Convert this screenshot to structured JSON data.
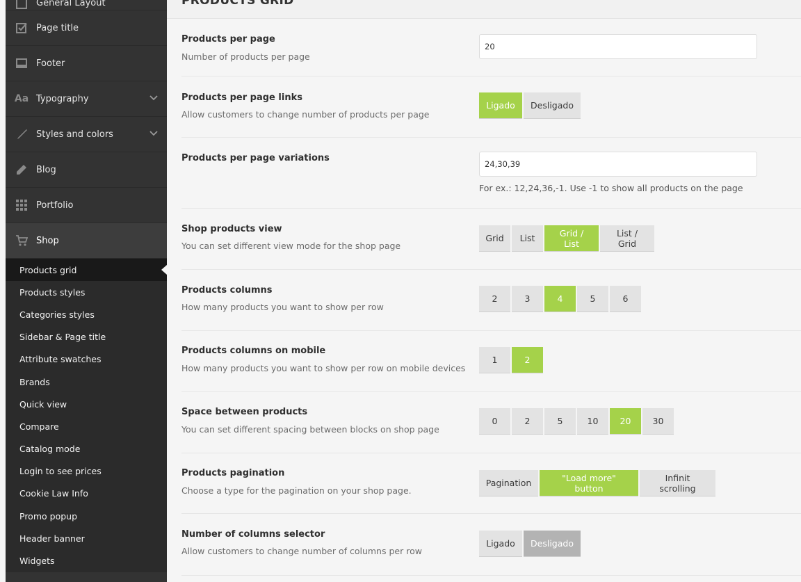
{
  "sidebar": {
    "items": [
      {
        "label": "General Layout",
        "icon": "layout-icon"
      },
      {
        "label": "Page title",
        "icon": "checkbox-icon"
      },
      {
        "label": "Footer",
        "icon": "footer-icon"
      },
      {
        "label": "Typography",
        "icon": "typography-icon",
        "chevron": true
      },
      {
        "label": "Styles and colors",
        "icon": "brush-icon",
        "chevron": true
      },
      {
        "label": "Blog",
        "icon": "pencil-icon"
      },
      {
        "label": "Portfolio",
        "icon": "grid-icon"
      },
      {
        "label": "Shop",
        "icon": "cart-icon",
        "active": true
      }
    ],
    "shop_submenu": [
      "Products grid",
      "Products styles",
      "Categories styles",
      "Sidebar & Page title",
      "Attribute swatches",
      "Brands",
      "Quick view",
      "Compare",
      "Catalog mode",
      "Login to see prices",
      "Cookie Law Info",
      "Promo popup",
      "Header banner",
      "Widgets"
    ],
    "typography_glyph": "Aa"
  },
  "main": {
    "title": "PRODUCTS GRID",
    "products_per_page": {
      "label": "Products per page",
      "desc": "Number of products per page",
      "value": "20"
    },
    "per_page_links": {
      "label": "Products per page links",
      "desc": "Allow customers to change number of products per page",
      "on": "Ligado",
      "off": "Desligado",
      "selected": "on"
    },
    "per_page_variations": {
      "label": "Products per page variations",
      "value": "24,30,39",
      "hint": "For ex.: 12,24,36,-1. Use -1 to show all products on the page"
    },
    "shop_view": {
      "label": "Shop products view",
      "desc": "You can set different view mode for the shop page",
      "options": [
        "Grid",
        "List",
        "Grid / List",
        "List / Grid"
      ],
      "selected": "Grid / List"
    },
    "columns": {
      "label": "Products columns",
      "desc": "How many products you want to show per row",
      "options": [
        "2",
        "3",
        "4",
        "5",
        "6"
      ],
      "selected": "4"
    },
    "columns_mobile": {
      "label": "Products columns on mobile",
      "desc": "How many products you want to show per row on mobile devices",
      "options": [
        "1",
        "2"
      ],
      "selected": "2"
    },
    "spacing": {
      "label": "Space between products",
      "desc": "You can set different spacing between blocks on shop page",
      "options": [
        "0",
        "2",
        "5",
        "10",
        "20",
        "30"
      ],
      "selected": "20"
    },
    "pagination": {
      "label": "Products pagination",
      "desc": "Choose a type for the pagination on your shop page.",
      "options": [
        "Pagination",
        "\"Load more\" button",
        "Infinit scrolling"
      ],
      "selected": "\"Load more\" button"
    },
    "columns_selector": {
      "label": "Number of columns selector",
      "desc": "Allow customers to change number of columns per row",
      "on": "Ligado",
      "off": "Desligado",
      "selected": "off"
    }
  },
  "colors": {
    "accent": "#a5d24a",
    "sidebar_bg": "#333333",
    "submenu_current": "#191919",
    "off_selected": "#b3b3b3"
  }
}
